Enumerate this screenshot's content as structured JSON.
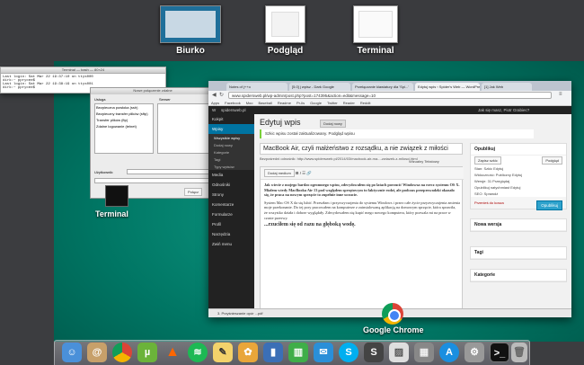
{
  "spaces": [
    {
      "label": "Biurko"
    },
    {
      "label": "Podgląd"
    },
    {
      "label": "Terminal"
    }
  ],
  "terminal": {
    "title": "Terminal — bash — 80×24",
    "line1": "Last login: Sat Mar 22 19:37:10 on ttys000",
    "line2": "dirk:~ pprycee$",
    "line3": "Last login: Sat Mar 22 19:38:19 on ttys001",
    "line4": "dirk:~ pprycee$",
    "label": "Terminal"
  },
  "dialog": {
    "title": "Nowe połączenie zdalne",
    "col1": "Usługa",
    "col2": "Serwer",
    "services": [
      "Bezpieczna powłoka (ssh)",
      "Bezpieczny transfer plików (sftp)",
      "Transfer plików (ftp)",
      "Zdalne logowanie (telnet)"
    ],
    "user_label": "Użytkownik:",
    "connect": "Połącz"
  },
  "chrome": {
    "tabs": [
      "Notes of j++o",
      "[5.0] j wpisz - Dark Google",
      "Przełączanie klawiatury dla 'Spi...'",
      "Edytuj wpis ‹ Spider's Web — WordPress",
      "[1] Jak Web"
    ],
    "url": "www.spidersweb.pl/wp-admin/post.php?post=174395&action=edit&message=10",
    "bookmarks": [
      "Apps",
      "Facebook",
      "Moo",
      "Baseball",
      "Readme",
      "Pr-lis",
      "Google",
      "Twitter",
      "Reader",
      "Reddit"
    ],
    "label": "Google Chrome",
    "download": "3. Przyśnieszanie opór ...pdf"
  },
  "wp": {
    "site": "spidersweb.pl",
    "topbar_right": "Jak się masz, Piotr Grabiec?",
    "menu": [
      "Kokpit",
      "Wpisy",
      "Media",
      "Odnośniki",
      "Strony",
      "Komentarze",
      "Formularze",
      "Profil",
      "Narzędzia",
      "Zwiń menu"
    ],
    "submenu": [
      "Wszystkie wpisy",
      "Dodaj nowy",
      "Kategorie",
      "Tagi",
      "Typy wpisów"
    ],
    "page_title": "Edytuj wpis",
    "add_new": "Dodaj nowy",
    "notice": "Szkic wpisu został zaktualizowany. Podgląd wpisu",
    "post_title": "MacBook Air, czyli małżeństwo z rozsądku, a nie związek z miłości",
    "permalink": "Bezpośredni odnośnik: http://www.spidersweb.pl/2014/03/macbook-air-ma...-zwiazek-z-milosci.html",
    "media_btn": "Dodaj medium",
    "visual": "Wizualny",
    "text": "Tekstowy",
    "para1": "Jak wiecie z mojego bardzo ogromnego wpisu, zdecydowałem się po latach porzucić Windowsa na rzecz systemu OS X. Miałem wtedy MacBooka Air 13 pod względem sprzętowym to faktycznie rodzi, ale podczas przeprowadzki okazało się, że praca na nowym sprzęcie to zupełnie inne uczucie.",
    "para2": "System Mac OS X da się lubić. Przeszłam i przyzwyczajenia do systemu Windows i przez całe życie przyzwyczajenia zmienia moje przekonanie. Do tej pory pracowałem na komputerze z zainstalowaną aplikacją na domowym sprzęcie, która sprawiła, że wszystko działa i dobrze wyglądały. Zdecydowałem się kupić mego nowego komputera, który pozwala mi na prace w czasie przerwy.",
    "heading": "...rzuciłem się od razu na głęboką wodę.",
    "publish": {
      "title": "Opublikuj",
      "save": "Zapisz szkic",
      "preview": "Podgląd",
      "status": "Stan: Szkic Edytuj",
      "visibility": "Widoczność: Publiczny Edytuj",
      "revisions": "Wersje: 31 Przeglądaj",
      "schedule": "Opublikuj natychmiast Edytuj",
      "seo": "SEO: Sprawdź",
      "trash": "Przenieś do kosza",
      "publish": "Opublikuj"
    },
    "boxes": [
      "Nowa wersja",
      "Tagi",
      "Kategorie"
    ]
  },
  "dock_icons": [
    "finder-icon",
    "contacts-icon",
    "chrome-icon",
    "utorrent-icon",
    "vlc-icon",
    "spotify-icon",
    "notes-icon",
    "photos-icon",
    "keynote-icon",
    "numbers-icon",
    "skype-icon",
    "sublime-icon",
    "preview-icon",
    "calculator-icon",
    "appstore-icon",
    "settings-icon",
    "terminal-icon",
    "trash-icon"
  ]
}
